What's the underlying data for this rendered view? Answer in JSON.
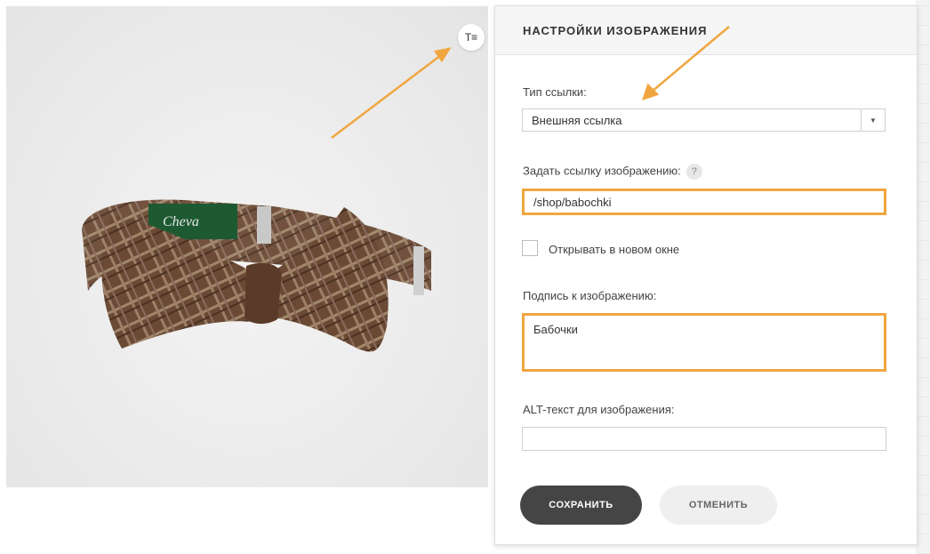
{
  "panel": {
    "title": "НАСТРОЙКИ ИЗОБРАЖЕНИЯ",
    "link_type_label": "Тип ссылки:",
    "link_type_value": "Внешняя ссылка",
    "link_label": "Задать ссылку изображению:",
    "help_icon_glyph": "?",
    "link_value": "/shop/babochki",
    "new_window_label": "Открывать в новом окне",
    "new_window_checked": false,
    "caption_label": "Подпись к изображению:",
    "caption_value": "Бабочки",
    "alt_label": "ALT-текст для изображения:",
    "alt_value": "",
    "save_label": "СОХРАНИТЬ",
    "cancel_label": "ОТМЕНИТЬ"
  },
  "photo": {
    "toggle_glyph": "T≡"
  },
  "colors": {
    "highlight": "#f0a63f",
    "save_button": "#454545",
    "cancel_button": "#efefef",
    "header_bg": "#f5f5f5"
  }
}
